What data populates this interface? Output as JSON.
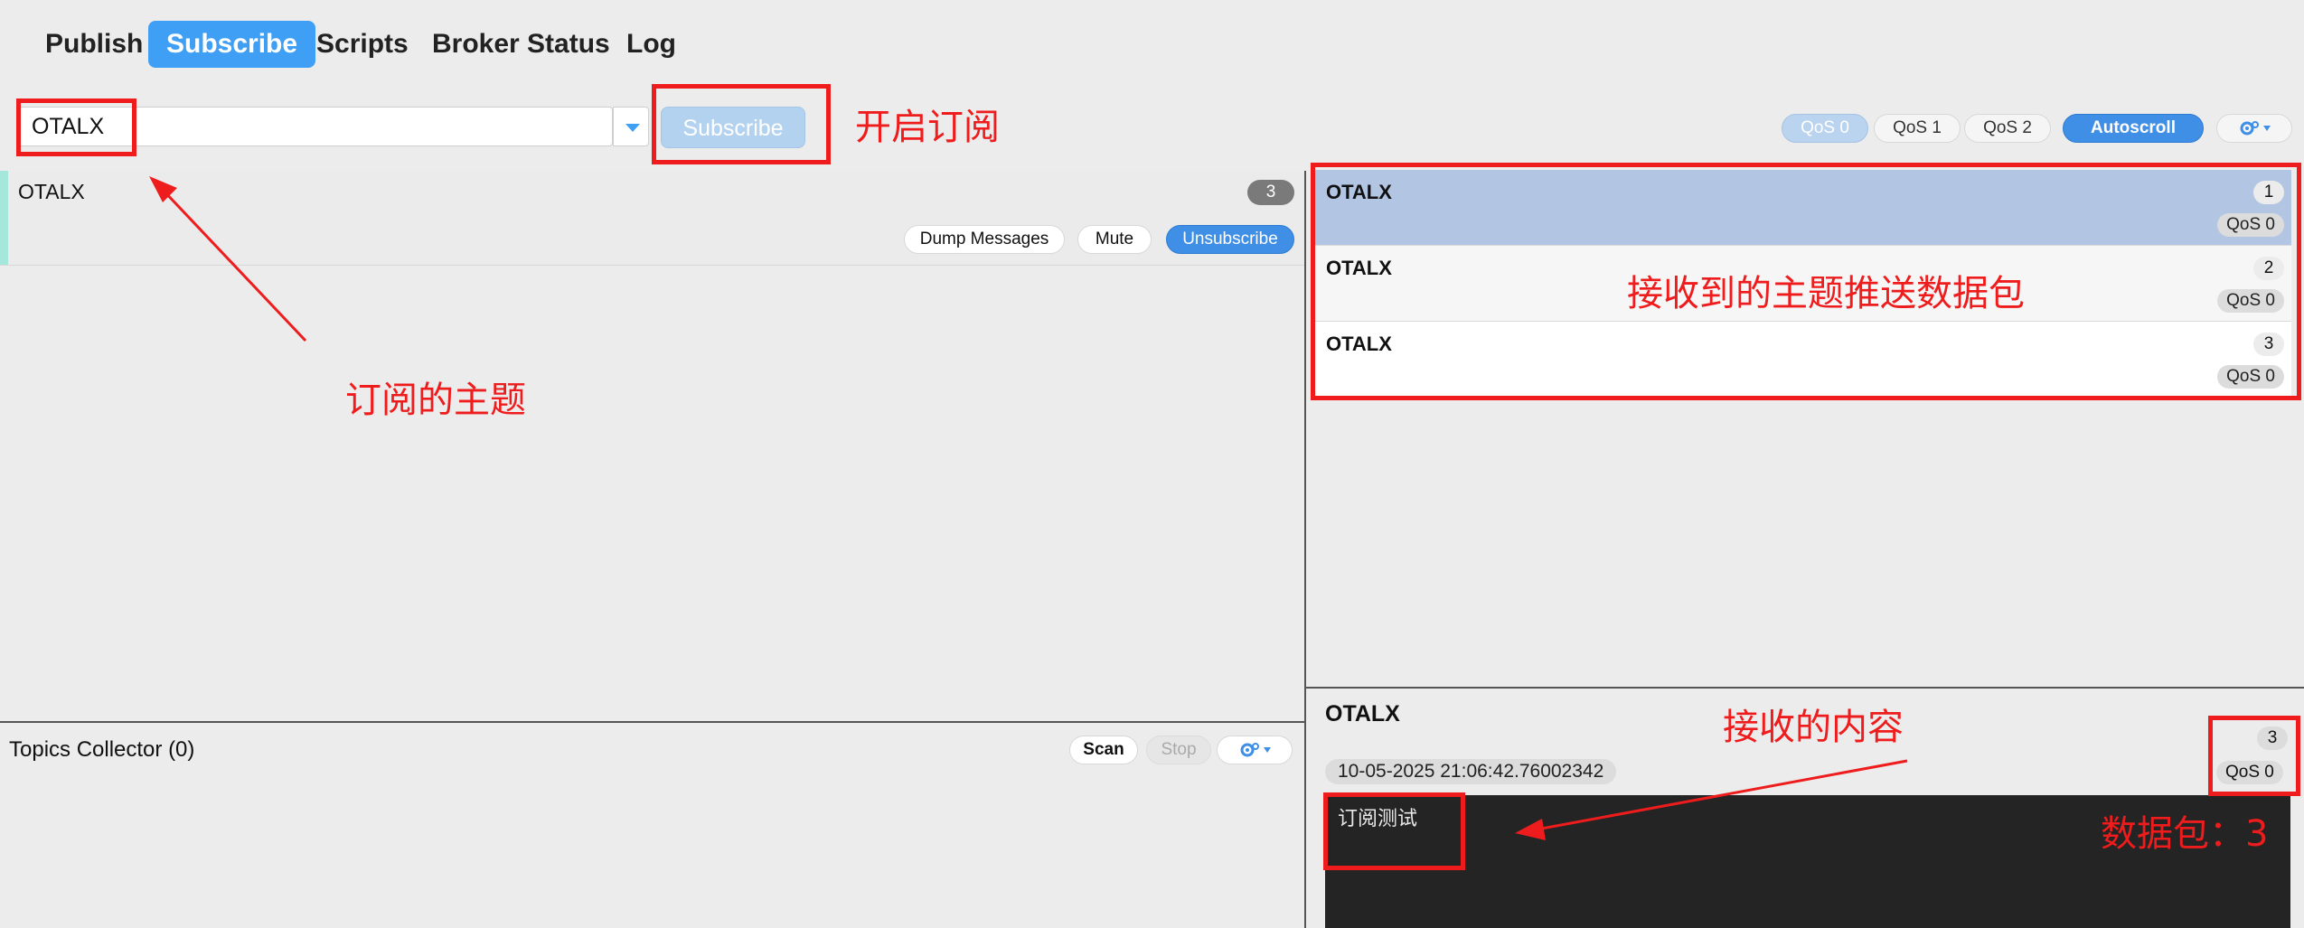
{
  "tabs": [
    "Publish",
    "Subscribe",
    "Scripts",
    "Broker Status",
    "Log"
  ],
  "subscribe_bar": {
    "topic_value": "OTALX",
    "subscribe_label": "Subscribe",
    "qos_options": [
      "QoS 0",
      "QoS 1",
      "QoS 2"
    ],
    "selected_qos": "QoS 0",
    "autoscroll_label": "Autoscroll",
    "settings_icon": "gear-icon"
  },
  "subscription": {
    "topic": "OTALX",
    "count": "3",
    "buttons": [
      "Dump Messages",
      "Mute",
      "Unsubscribe"
    ]
  },
  "topics_collector": {
    "title": "Topics Collector (0)",
    "scan_label": "Scan",
    "stop_label": "Stop"
  },
  "messages": [
    {
      "topic": "OTALX",
      "num": "1",
      "qos": "QoS 0"
    },
    {
      "topic": "OTALX",
      "num": "2",
      "qos": "QoS 0"
    },
    {
      "topic": "OTALX",
      "num": "3",
      "qos": "QoS 0"
    }
  ],
  "detail": {
    "topic": "OTALX",
    "num": "3",
    "qos": "QoS 0",
    "timestamp": "10-05-2025  21:06:42.76002342",
    "payload": "订阅测试"
  },
  "annotations": {
    "open_subscribe": "开启订阅",
    "subscribed_topic": "订阅的主题",
    "received_packets": "接收到的主题推送数据包",
    "received_content": "接收的内容",
    "packet_number": "数据包：3"
  },
  "colors": {
    "accent": "#3f9ff5",
    "annotation_red": "#ee1c1c",
    "selected_row": "#b2c5e3",
    "payload_bg": "#242424"
  }
}
